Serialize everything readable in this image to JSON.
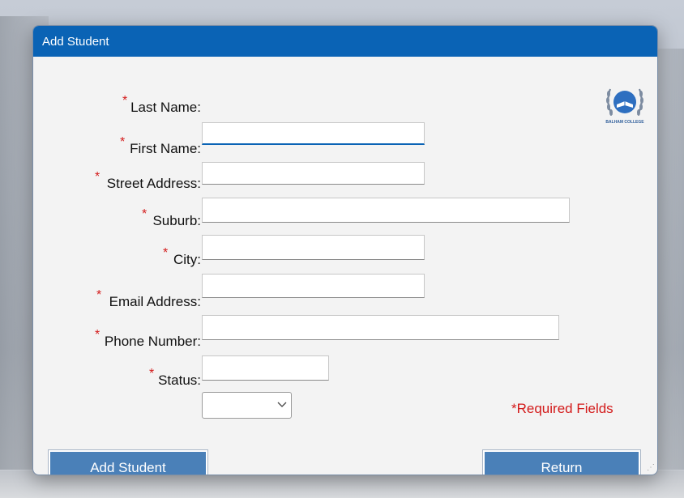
{
  "window": {
    "title": "Add Student"
  },
  "logo": {
    "text": "BALHAM COLLEGE",
    "icon": "book-laurel-logo"
  },
  "form": {
    "required_marker": "*",
    "fields": [
      {
        "label": "Last Name:",
        "value": ""
      },
      {
        "label": "First Name:",
        "value": ""
      },
      {
        "label": "Street Address:",
        "value": ""
      },
      {
        "label": "Suburb:",
        "value": ""
      },
      {
        "label": "City:",
        "value": ""
      },
      {
        "label": "Email Address:",
        "value": ""
      },
      {
        "label": "Phone Number:",
        "value": ""
      },
      {
        "label": "Status:",
        "value": ""
      }
    ],
    "required_note": "*Required Fields"
  },
  "buttons": {
    "add": "Add Student",
    "return": "Return"
  },
  "colors": {
    "titlebar": "#0a63b5",
    "button": "#4a80b8",
    "required": "#d31a1a"
  }
}
